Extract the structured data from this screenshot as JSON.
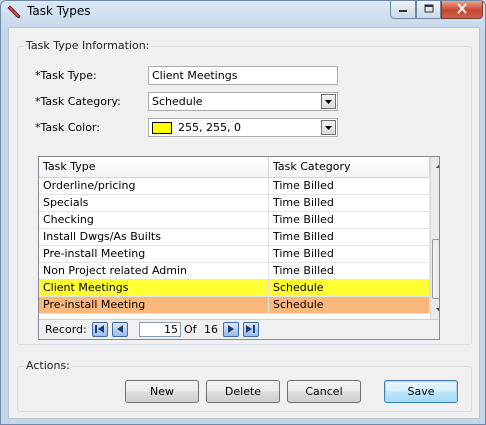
{
  "window": {
    "title": "Task Types",
    "icon": "pencil-icon",
    "controls": [
      "minimize-icon",
      "maximize-icon",
      "close-icon"
    ]
  },
  "form": {
    "group_title": "Task Type Information:",
    "task_type_label": "*Task Type:",
    "task_type_value": "Client Meetings",
    "task_category_label": "*Task Category:",
    "task_category_value": "Schedule",
    "task_color_label": "*Task Color:",
    "task_color_value": "255, 255, 0",
    "task_color_swatch": "#ffff00"
  },
  "grid": {
    "columns": [
      "Task Type",
      "Task Category"
    ],
    "rows": [
      {
        "task_type": "Orderline/pricing",
        "task_category": "Time Billed",
        "bg": "#ffffff"
      },
      {
        "task_type": "Specials",
        "task_category": "Time Billed",
        "bg": "#ffffff"
      },
      {
        "task_type": "Checking",
        "task_category": "Time Billed",
        "bg": "#ffffff"
      },
      {
        "task_type": "Install Dwgs/As Builts",
        "task_category": "Time Billed",
        "bg": "#ffffff"
      },
      {
        "task_type": "Pre-install Meeting",
        "task_category": "Time Billed",
        "bg": "#ffffff"
      },
      {
        "task_type": "Non Project related Admin",
        "task_category": "Time Billed",
        "bg": "#ffffff"
      },
      {
        "task_type": "Client Meetings",
        "task_category": "Schedule",
        "bg": "#ffff33"
      },
      {
        "task_type": "Pre-install Meeting",
        "task_category": "Schedule",
        "bg": "#fcb77a"
      }
    ],
    "navigator": {
      "record_label": "Record:",
      "current": "15",
      "of_label": "Of",
      "total": "16"
    }
  },
  "actions": {
    "group_title": "Actions:",
    "new_label": "New",
    "delete_label": "Delete",
    "cancel_label": "Cancel",
    "save_label": "Save"
  }
}
